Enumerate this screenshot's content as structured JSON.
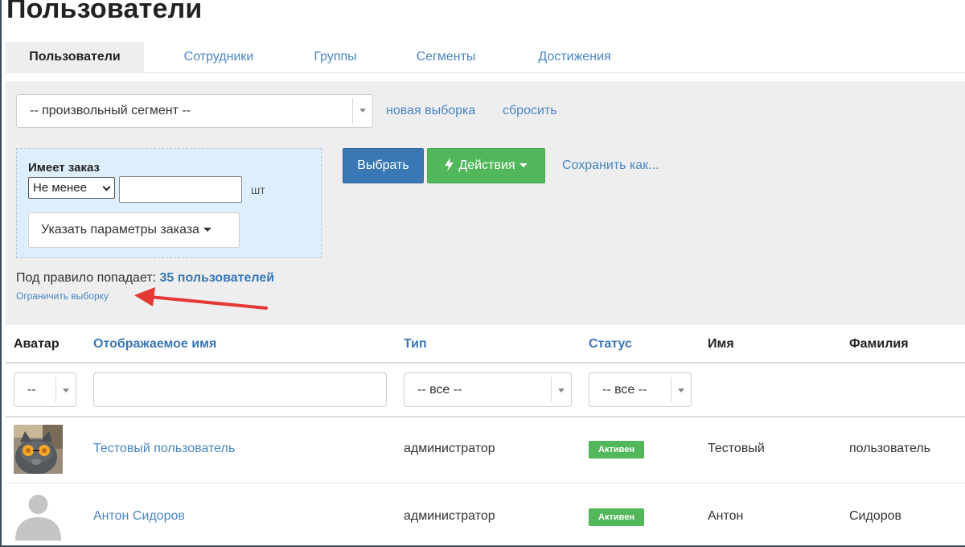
{
  "page": {
    "title": "Пользователи"
  },
  "tabs": [
    {
      "label": "Пользователи",
      "active": true
    },
    {
      "label": "Сотрудники",
      "active": false
    },
    {
      "label": "Группы",
      "active": false
    },
    {
      "label": "Сегменты",
      "active": false
    },
    {
      "label": "Достижения",
      "active": false
    }
  ],
  "filters": {
    "segment_select": {
      "value": "-- произвольный сегмент --"
    },
    "new_selection_link": "новая выборка",
    "reset_link": "сбросить",
    "rule": {
      "title": "Имеет заказ",
      "comparator": "Не менее",
      "count_value": "",
      "unit": "шт",
      "order_params_button": "Указать параметры заказа"
    },
    "select_button": "Выбрать",
    "actions_button": "Действия",
    "save_as_link": "Сохранить как...",
    "match_prefix": "Под правило попадает: ",
    "match_count": "35 пользователей",
    "limit_link": "Ограничить выборку"
  },
  "table": {
    "columns": [
      "Аватар",
      "Отображаемое имя",
      "Тип",
      "Статус",
      "Имя",
      "Фамилия"
    ],
    "filter_row": {
      "avatar_filter": "--",
      "name_filter": "",
      "type_filter": "-- все --",
      "status_filter": "-- все --"
    },
    "rows": [
      {
        "avatar": "cat-photo",
        "display_name": "Тестовый пользователь",
        "type": "администратор",
        "status": "Активен",
        "first_name": "Тестовый",
        "last_name": "пользователь"
      },
      {
        "avatar": "default-user",
        "display_name": "Антон Сидоров",
        "type": "администратор",
        "status": "Активен",
        "first_name": "Антон",
        "last_name": "Сидоров"
      }
    ]
  },
  "colors": {
    "link": "#4a86c5",
    "primary": "#3a77b5",
    "success": "#52b75b",
    "panel": "#eeeeee",
    "rule_bg": "#ddeefc",
    "annotation_arrow": "#e53935"
  },
  "icons": {
    "actions": "bolt-icon",
    "dropdown": "caret-down-icon",
    "annotation": "red-arrow-icon"
  }
}
